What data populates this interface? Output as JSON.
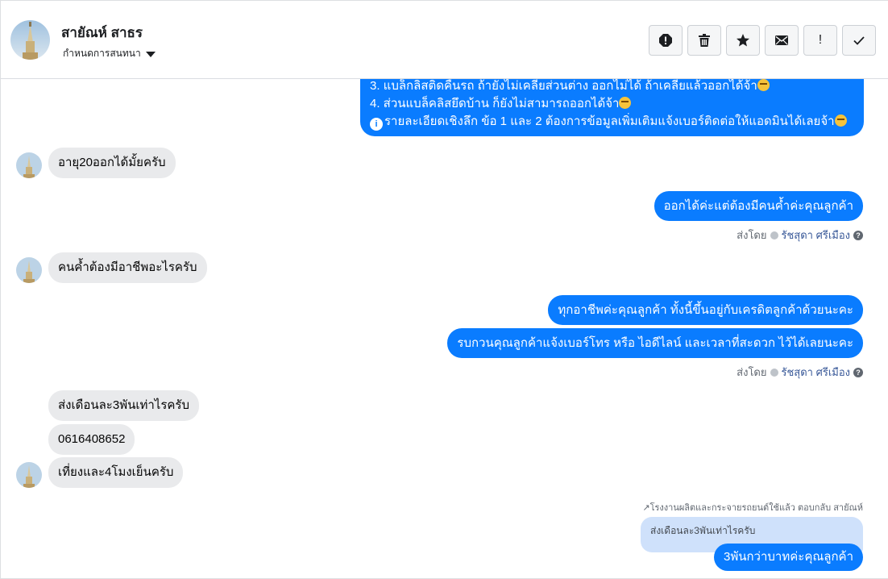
{
  "header": {
    "name": "สายัณห์ สาธร",
    "subtitle": "กำหนดการสนทนา"
  },
  "actions": [
    {
      "icon": "alert-icon"
    },
    {
      "icon": "trash-icon"
    },
    {
      "icon": "star-icon"
    },
    {
      "icon": "mail-icon"
    },
    {
      "icon": "exclamation-icon",
      "label": "!"
    },
    {
      "icon": "check-icon"
    }
  ],
  "messages": {
    "big_line_3": "3. แบล็กลิสติดคืนรถ ถ้ายังไม่เคลียส่วนต่าง ออกไม่ได้ ถ้าเคลียแล้วออกได้จ้า",
    "big_line_4": "4. ส่วนแบล็คลิสยึดบ้าน ก็ยังไม่สามารถออกได้จ้า",
    "big_line_5": "รายละเอียดเชิงลึก ข้อ 1 และ 2 ต้องการข้อมูลเพิ่มเติมแจ้งเบอร์ติดต่อให้แอดมินได้เลยจ้า",
    "in_1": "อายุ20ออกได้มั้ยครับ",
    "out_1": "ออกได้ค่ะแต่ต้องมีคนค้ำค่ะคุณลูกค้า",
    "in_2": "คนค้ำต้องมีอาชีพอะไรครับ",
    "out_2": "ทุกอาชีพค่ะคุณลูกค้า  ทั้งนี้ขึ้นอยู่กับเครดิตลูกค้าด้วยนะคะ",
    "out_3": "รบกวนคุณลูกค้าแจ้งเบอร์โทร หรือ ไอดีไลน์ และเวลาที่สะดวก ไว้ได้เลยนะคะ",
    "in_3": "ส่งเดือนละ3พันเท่าไรครับ",
    "in_4": "0616408652",
    "in_5": "เที่ยงและ4โมงเย็นครับ",
    "reply_note": "โรงงานผลิตและกระจายรถยนต์ใช้แล้ว ตอบกลับ สายัณห์",
    "quoted": "ส่งเดือนละ3พันเท่าไรครับ",
    "out_4": "3พันกว่าบาทค่ะคุณลูกค้า"
  },
  "sent_by": {
    "label": "ส่งโดย",
    "agent": "รัชสุดา ศรีเมือง"
  }
}
